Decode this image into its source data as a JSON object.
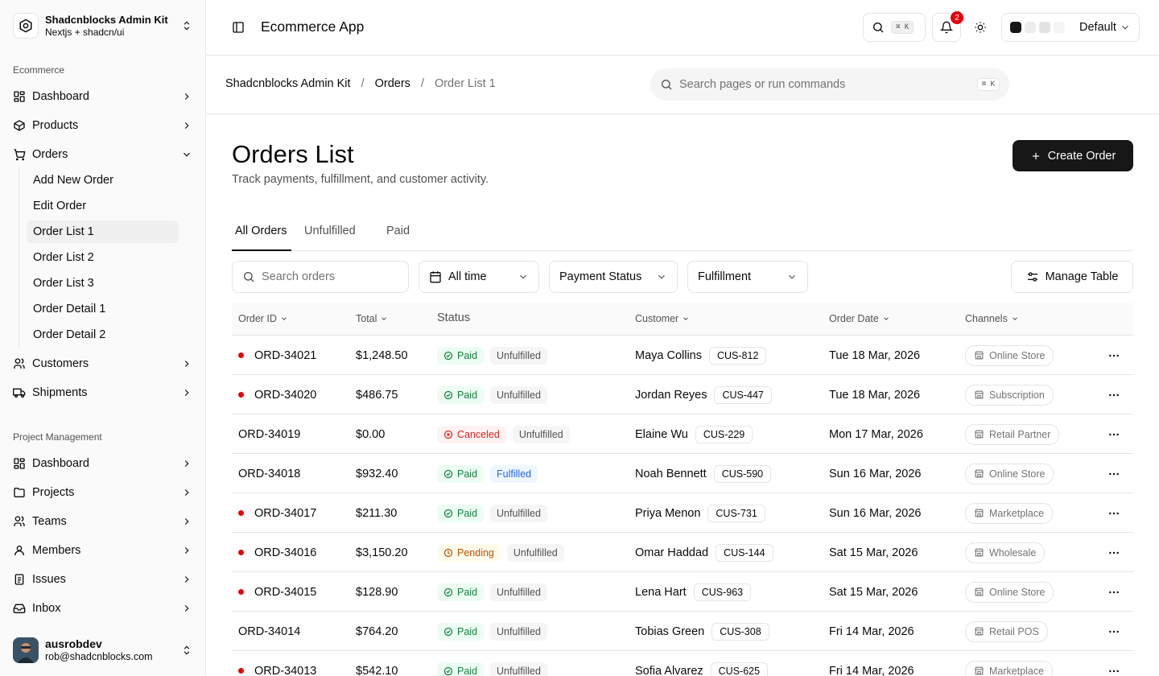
{
  "sidebar": {
    "brand_title": "Shadcnblocks Admin Kit",
    "brand_sub": "Nextjs + shadcn/ui",
    "group1_label": "Ecommerce",
    "group2_label": "Project Management",
    "ecommerce_items": [
      {
        "label": "Dashboard",
        "icon": "layout-dashboard-icon"
      },
      {
        "label": "Products",
        "icon": "package-icon"
      },
      {
        "label": "Orders",
        "icon": "shopping-cart-icon"
      },
      {
        "label": "Customers",
        "icon": "users-icon"
      },
      {
        "label": "Shipments",
        "icon": "truck-icon"
      }
    ],
    "order_subitems": [
      "Add New Order",
      "Edit Order",
      "Order List 1",
      "Order List 2",
      "Order List 3",
      "Order Detail 1",
      "Order Detail 2"
    ],
    "project_items": [
      {
        "label": "Dashboard",
        "icon": "layout-dashboard-icon"
      },
      {
        "label": "Projects",
        "icon": "folder-icon"
      },
      {
        "label": "Teams",
        "icon": "users-icon"
      },
      {
        "label": "Members",
        "icon": "user-icon"
      },
      {
        "label": "Issues",
        "icon": "clipboard-list-icon"
      },
      {
        "label": "Inbox",
        "icon": "inbox-icon"
      }
    ],
    "user": {
      "name": "ausrobdev",
      "email": "rob@shadcnblocks.com"
    }
  },
  "topbar": {
    "app_title": "Ecommerce App",
    "search_kbd": "⌘ K",
    "notification_count": "2",
    "theme_label": "Default",
    "theme_swatches": [
      "#171717",
      "#ececec",
      "#e2e2e2",
      "#f5f5f5"
    ]
  },
  "breadcrumb": {
    "items": [
      "Shadcnblocks Admin Kit",
      "Orders",
      "Order List 1"
    ],
    "search_placeholder": "Search pages or run commands",
    "search_kbd": "⌘ K"
  },
  "main": {
    "title": "Orders List",
    "subtitle": "Track payments, fulfillment, and customer activity.",
    "create_button": "Create Order",
    "tabs": [
      "All Orders",
      "Unfulfilled",
      "Paid"
    ],
    "filters": {
      "search_placeholder": "Search orders",
      "date": "All time",
      "payment": "Payment Status",
      "fulfillment": "Fulfillment",
      "manage": "Manage Table"
    }
  },
  "table": {
    "headers": [
      "Order ID",
      "Total",
      "Status",
      "Customer",
      "Order Date",
      "Channels"
    ],
    "rows": [
      {
        "id": "ORD-34021",
        "dot": true,
        "total": "$1,248.50",
        "payment": "Paid",
        "fulfillment": "Unfulfilled",
        "customer": "Maya Collins",
        "cid": "CUS-812",
        "date": "Tue 18 Mar, 2026",
        "channel": "Online Store"
      },
      {
        "id": "ORD-34020",
        "dot": true,
        "total": "$486.75",
        "payment": "Paid",
        "fulfillment": "Unfulfilled",
        "customer": "Jordan Reyes",
        "cid": "CUS-447",
        "date": "Tue 18 Mar, 2026",
        "channel": "Subscription"
      },
      {
        "id": "ORD-34019",
        "dot": false,
        "total": "$0.00",
        "payment": "Canceled",
        "fulfillment": "Unfulfilled",
        "customer": "Elaine Wu",
        "cid": "CUS-229",
        "date": "Mon 17 Mar, 2026",
        "channel": "Retail Partner"
      },
      {
        "id": "ORD-34018",
        "dot": false,
        "total": "$932.40",
        "payment": "Paid",
        "fulfillment": "Fulfilled",
        "customer": "Noah Bennett",
        "cid": "CUS-590",
        "date": "Sun 16 Mar, 2026",
        "channel": "Online Store"
      },
      {
        "id": "ORD-34017",
        "dot": true,
        "total": "$211.30",
        "payment": "Paid",
        "fulfillment": "Unfulfilled",
        "customer": "Priya Menon",
        "cid": "CUS-731",
        "date": "Sun 16 Mar, 2026",
        "channel": "Marketplace"
      },
      {
        "id": "ORD-34016",
        "dot": true,
        "total": "$3,150.20",
        "payment": "Pending",
        "fulfillment": "Unfulfilled",
        "customer": "Omar Haddad",
        "cid": "CUS-144",
        "date": "Sat 15 Mar, 2026",
        "channel": "Wholesale"
      },
      {
        "id": "ORD-34015",
        "dot": true,
        "total": "$128.90",
        "payment": "Paid",
        "fulfillment": "Unfulfilled",
        "customer": "Lena Hart",
        "cid": "CUS-963",
        "date": "Sat 15 Mar, 2026",
        "channel": "Online Store"
      },
      {
        "id": "ORD-34014",
        "dot": false,
        "total": "$764.20",
        "payment": "Paid",
        "fulfillment": "Unfulfilled",
        "customer": "Tobias Green",
        "cid": "CUS-308",
        "date": "Fri 14 Mar, 2026",
        "channel": "Retail POS"
      },
      {
        "id": "ORD-34013",
        "dot": true,
        "total": "$542.10",
        "payment": "Paid",
        "fulfillment": "Unfulfilled",
        "customer": "Sofia Alvarez",
        "cid": "CUS-625",
        "date": "Fri 14 Mar, 2026",
        "channel": "Marketplace"
      }
    ]
  }
}
